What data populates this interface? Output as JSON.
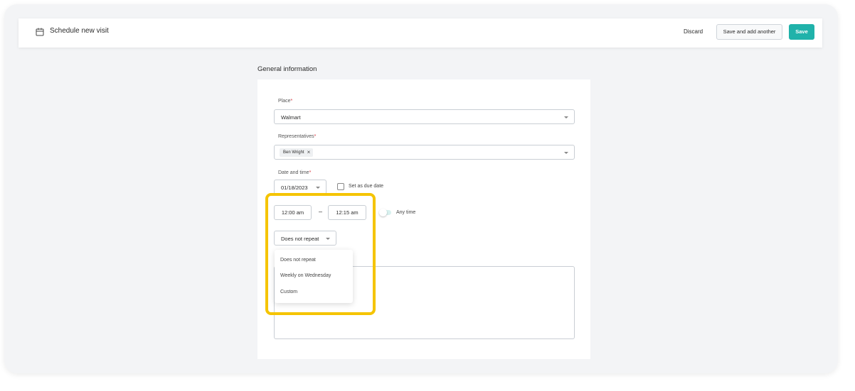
{
  "header": {
    "title": "Schedule new visit",
    "discard_label": "Discard",
    "save_add_label": "Save and add another",
    "save_label": "Save"
  },
  "section": {
    "title": "General information"
  },
  "form": {
    "place_label": "Place",
    "place_value": "Walmart",
    "reps_label": "Representatives",
    "rep_chip": "Ben Wright",
    "datetime_label": "Date and time",
    "date_value": "01/18/2023",
    "due_date_label": "Set as due date",
    "start_time": "12:00 am",
    "end_time": "12:15 am",
    "separator": "–",
    "any_time_label": "Any time",
    "repeat_value": "Does not repeat",
    "required_mark": "*"
  },
  "repeat_options": [
    "Does not repeat",
    "Weekly on Wednesday",
    "Custom"
  ],
  "colors": {
    "accent": "#20b2aa",
    "highlight": "#f5c400",
    "required": "#d9363e"
  }
}
